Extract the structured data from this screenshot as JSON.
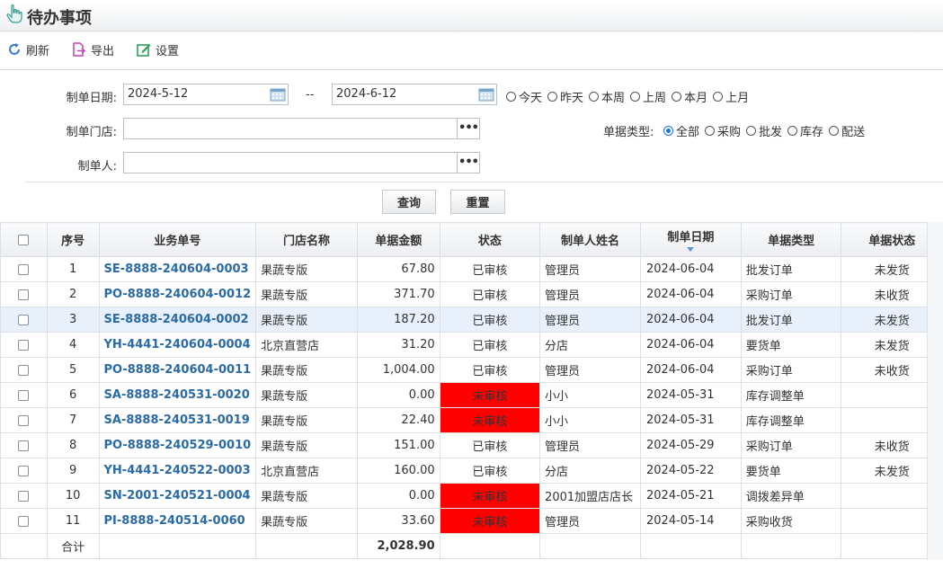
{
  "title": "待办事项",
  "toolbar": {
    "refresh": "刷新",
    "export": "导出",
    "settings": "设置"
  },
  "filters": {
    "date_label": "制单日期:",
    "date_from": "2024-5-12",
    "date_sep": "--",
    "date_to": "2024-6-12",
    "date_quick": [
      "今天",
      "昨天",
      "本周",
      "上周",
      "本月",
      "上月"
    ],
    "store_label": "制单门店:",
    "store_value": "",
    "creator_label": "制单人:",
    "creator_value": "",
    "doc_type_label": "单据类型:",
    "doc_types": [
      "全部",
      "采购",
      "批发",
      "库存",
      "配送"
    ],
    "doc_type_selected": "全部",
    "dots": "•••"
  },
  "buttons": {
    "query": "查询",
    "reset": "重置"
  },
  "table": {
    "headers": [
      "序号",
      "业务单号",
      "门店名称",
      "单据金额",
      "状态",
      "制单人姓名",
      "制单日期",
      "单据类型",
      "单据状态"
    ],
    "rows": [
      {
        "no": "1",
        "id": "SE-8888-240604-0003",
        "store": "果蔬专版",
        "amount": "67.80",
        "status": "已审核",
        "creator": "管理员",
        "date": "2024-06-04",
        "type": "批发订单",
        "doc_status": "未发货"
      },
      {
        "no": "2",
        "id": "PO-8888-240604-0012",
        "store": "果蔬专版",
        "amount": "371.70",
        "status": "已审核",
        "creator": "管理员",
        "date": "2024-06-04",
        "type": "采购订单",
        "doc_status": "未收货"
      },
      {
        "no": "3",
        "id": "SE-8888-240604-0002",
        "store": "果蔬专版",
        "amount": "187.20",
        "status": "已审核",
        "creator": "管理员",
        "date": "2024-06-04",
        "type": "批发订单",
        "doc_status": "未发货"
      },
      {
        "no": "4",
        "id": "YH-4441-240604-0004",
        "store": "北京直营店",
        "amount": "31.20",
        "status": "已审核",
        "creator": "分店",
        "date": "2024-06-04",
        "type": "要货单",
        "doc_status": "未发货"
      },
      {
        "no": "5",
        "id": "PO-8888-240604-0011",
        "store": "果蔬专版",
        "amount": "1,004.00",
        "status": "已审核",
        "creator": "管理员",
        "date": "2024-06-04",
        "type": "采购订单",
        "doc_status": "未收货"
      },
      {
        "no": "6",
        "id": "SA-8888-240531-0020",
        "store": "果蔬专版",
        "amount": "0.00",
        "status": "未审核",
        "creator": "小小",
        "date": "2024-05-31",
        "type": "库存调整单",
        "doc_status": ""
      },
      {
        "no": "7",
        "id": "SA-8888-240531-0019",
        "store": "果蔬专版",
        "amount": "22.40",
        "status": "未审核",
        "creator": "小小",
        "date": "2024-05-31",
        "type": "库存调整单",
        "doc_status": ""
      },
      {
        "no": "8",
        "id": "PO-8888-240529-0010",
        "store": "果蔬专版",
        "amount": "151.00",
        "status": "已审核",
        "creator": "管理员",
        "date": "2024-05-29",
        "type": "采购订单",
        "doc_status": "未收货"
      },
      {
        "no": "9",
        "id": "YH-4441-240522-0003",
        "store": "北京直营店",
        "amount": "160.00",
        "status": "已审核",
        "creator": "分店",
        "date": "2024-05-22",
        "type": "要货单",
        "doc_status": "未发货"
      },
      {
        "no": "10",
        "id": "SN-2001-240521-0004",
        "store": "果蔬专版",
        "amount": "0.00",
        "status": "未审核",
        "creator": "2001加盟店店长",
        "date": "2024-05-21",
        "type": "调拨差异单",
        "doc_status": ""
      },
      {
        "no": "11",
        "id": "PI-8888-240514-0060",
        "store": "果蔬专版",
        "amount": "33.60",
        "status": "未审核",
        "creator": "管理员",
        "date": "2024-05-14",
        "type": "采购收货",
        "doc_status": ""
      }
    ],
    "total_label": "合计",
    "total_amount": "2,028.90",
    "highlight_row": 3
  },
  "colors": {
    "link": "#2a6aa8",
    "unapproved_bg": "#ff0000",
    "highlight_row": "#e8f1fb",
    "radio_checked": "#1a73e8"
  }
}
